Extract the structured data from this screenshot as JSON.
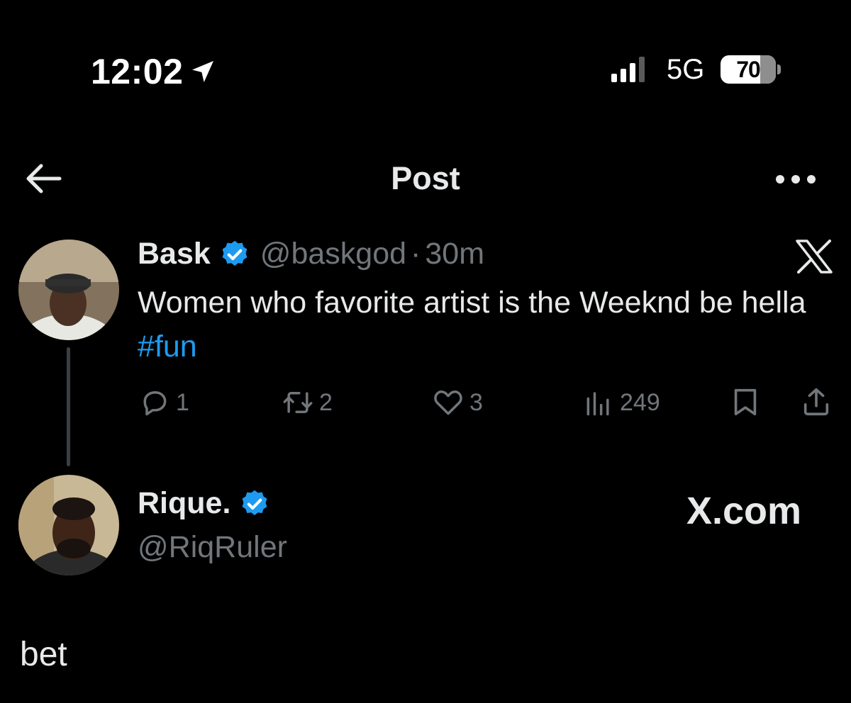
{
  "status_bar": {
    "time": "12:02",
    "network": "5G",
    "battery": "70"
  },
  "header": {
    "title": "Post"
  },
  "original_post": {
    "name": "Bask",
    "handle": "@baskgod",
    "separator": "·",
    "time": "30m",
    "text": "Women who favorite artist is the Weeknd be hella ",
    "hashtag": "#fun",
    "actions": {
      "replies": "1",
      "reposts": "2",
      "likes": "3",
      "views": "249"
    }
  },
  "reply_post": {
    "name": "Rique.",
    "handle": "@RiqRuler",
    "text": "bet"
  },
  "watermark": {
    "site": "X.com"
  },
  "colors": {
    "background": "#000000",
    "text": "#e7e9ea",
    "muted": "#71767b",
    "accent": "#1d9bf0",
    "thread_line": "#3a3f44"
  },
  "icons": [
    "location-arrow-icon",
    "signal-icon",
    "battery-icon",
    "back-arrow-icon",
    "more-icon",
    "verified-badge-icon",
    "x-logo-icon",
    "reply-icon",
    "repost-icon",
    "like-icon",
    "views-icon",
    "bookmark-icon",
    "share-icon"
  ]
}
